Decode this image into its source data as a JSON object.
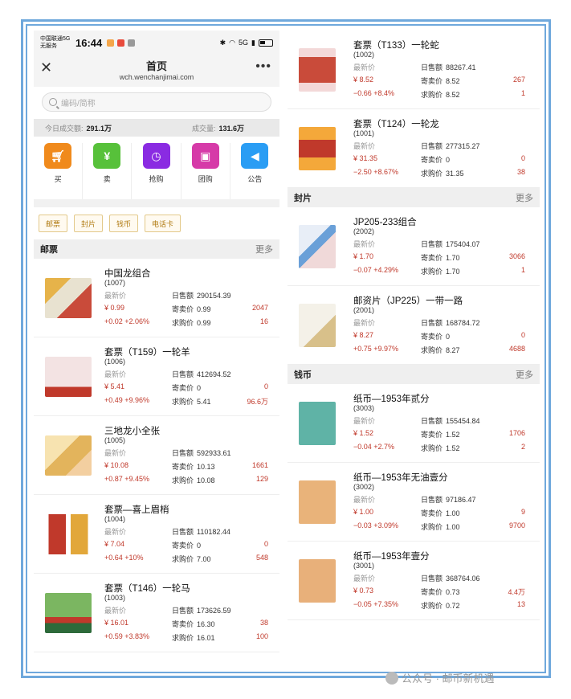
{
  "statusbar": {
    "carrier": "中国联通5G",
    "carrier_sub": "无服务",
    "time": "16:44",
    "network": "5G"
  },
  "nav": {
    "title": "首页",
    "url": "wch.wenchanjimai.com",
    "more": "•••"
  },
  "search": {
    "placeholder": "编码/简称"
  },
  "stats": {
    "today_label": "今日成交额:",
    "today_value": "291.1万",
    "volume_label": "成交量:",
    "volume_value": "131.6万"
  },
  "quick": [
    {
      "label": "买",
      "icon": "cart-icon",
      "color": "#f08a1c"
    },
    {
      "label": "卖",
      "icon": "yen-icon",
      "color": "#57c13a"
    },
    {
      "label": "抢购",
      "icon": "clock-icon",
      "color": "#8a2be2"
    },
    {
      "label": "团购",
      "icon": "wallet-icon",
      "color": "#d63aa8"
    },
    {
      "label": "公告",
      "icon": "speaker-icon",
      "color": "#2a9df4"
    }
  ],
  "categories": [
    "邮票",
    "封片",
    "钱币",
    "电话卡"
  ],
  "labels": {
    "latest": "最新价",
    "daily": "日售额",
    "sell": "寄卖价",
    "buy": "求购价",
    "more": "更多"
  },
  "sections": {
    "stamps": "邮票",
    "covers": "封片",
    "coins": "钱币"
  },
  "stamps": [
    {
      "name": "中国龙组合",
      "code": "(1007)",
      "price": "¥ 0.99",
      "daily": "290154.39",
      "sell": "0.99",
      "sell_count": "2047",
      "change": "+0.02 +2.06%",
      "buy": "0.99",
      "buy_count": "16"
    },
    {
      "name": "套票（T159）一轮羊",
      "code": "(1006)",
      "price": "¥ 5.41",
      "daily": "412694.52",
      "sell": "0",
      "sell_count": "0",
      "change": "+0.49 +9.96%",
      "buy": "5.41",
      "buy_count": "96.6万"
    },
    {
      "name": "三地龙小全张",
      "code": "(1005)",
      "price": "¥ 10.08",
      "daily": "592933.61",
      "sell": "10.13",
      "sell_count": "1661",
      "change": "+0.87 +9.45%",
      "buy": "10.08",
      "buy_count": "129"
    },
    {
      "name": "套票—喜上眉梢",
      "code": "(1004)",
      "price": "¥ 7.04",
      "daily": "110182.44",
      "sell": "0",
      "sell_count": "0",
      "change": "+0.64 +10%",
      "buy": "7.00",
      "buy_count": "548"
    },
    {
      "name": "套票（T146）一轮马",
      "code": "(1003)",
      "price": "¥ 16.01",
      "daily": "173626.59",
      "sell": "16.30",
      "sell_count": "38",
      "change": "+0.59 +3.83%",
      "buy": "16.01",
      "buy_count": "100"
    }
  ],
  "stamps_right": [
    {
      "name": "套票（T133）一轮蛇",
      "code": "(1002)",
      "price": "¥ 8.52",
      "daily": "88267.41",
      "sell": "8.52",
      "sell_count": "267",
      "change": "−0.66 +8.4%",
      "buy": "8.52",
      "buy_count": "1"
    },
    {
      "name": "套票（T124）一轮龙",
      "code": "(1001)",
      "price": "¥ 31.35",
      "daily": "277315.27",
      "sell": "0",
      "sell_count": "0",
      "change": "−2.50 +8.67%",
      "buy": "31.35",
      "buy_count": "38"
    }
  ],
  "covers": [
    {
      "name": "JP205-233组合",
      "code": "(2002)",
      "price": "¥ 1.70",
      "daily": "175404.07",
      "sell": "1.70",
      "sell_count": "3066",
      "change": "−0.07 +4.29%",
      "buy": "1.70",
      "buy_count": "1"
    },
    {
      "name": "邮资片（JP225）一带一路",
      "code": "(2001)",
      "price": "¥ 8.27",
      "daily": "168784.72",
      "sell": "0",
      "sell_count": "0",
      "change": "+0.75 +9.97%",
      "buy": "8.27",
      "buy_count": "4688"
    }
  ],
  "coins": [
    {
      "name": "纸币—1953年贰分",
      "code": "(3003)",
      "price": "¥ 1.52",
      "daily": "155454.84",
      "sell": "1.52",
      "sell_count": "1706",
      "change": "−0.04 +2.7%",
      "buy": "1.52",
      "buy_count": "2"
    },
    {
      "name": "纸币—1953年无油壹分",
      "code": "(3002)",
      "price": "¥ 1.00",
      "daily": "97186.47",
      "sell": "1.00",
      "sell_count": "9",
      "change": "−0.03 +3.09%",
      "buy": "1.00",
      "buy_count": "9700"
    },
    {
      "name": "纸币—1953年壹分",
      "code": "(3001)",
      "price": "¥ 0.73",
      "daily": "368764.06",
      "sell": "0.73",
      "sell_count": "4.4万",
      "change": "−0.05 +7.35%",
      "buy": "0.72",
      "buy_count": "13"
    }
  ],
  "watermark": "公众号 · 邮币新机遇"
}
